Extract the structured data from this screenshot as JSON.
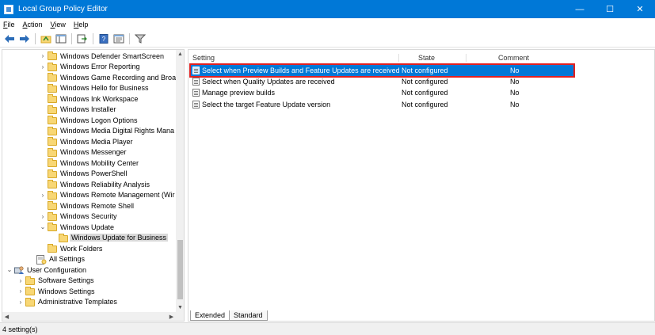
{
  "window": {
    "title": "Local Group Policy Editor",
    "controls": {
      "minimize": "—",
      "maximize": "☐",
      "close": "✕"
    }
  },
  "menu": [
    {
      "label": "File",
      "accel": "F",
      "rest": "ile"
    },
    {
      "label": "Action",
      "accel": "A",
      "rest": "ction"
    },
    {
      "label": "View",
      "accel": "V",
      "rest": "iew"
    },
    {
      "label": "Help",
      "accel": "H",
      "rest": "elp"
    }
  ],
  "toolbar": {
    "icons": [
      "back-arrow-icon",
      "forward-arrow-icon",
      "up-folder-icon",
      "show-hide-tree-icon",
      "export-list-icon",
      "help-icon",
      "properties-icon",
      "filter-icon"
    ]
  },
  "tree": {
    "items": [
      {
        "label": "Windows Defender SmartScreen",
        "level": 3,
        "expander": "›"
      },
      {
        "label": "Windows Error Reporting",
        "level": 3,
        "expander": "›"
      },
      {
        "label": "Windows Game Recording and Broa",
        "level": 3,
        "expander": ""
      },
      {
        "label": "Windows Hello for Business",
        "level": 3,
        "expander": ""
      },
      {
        "label": "Windows Ink Workspace",
        "level": 3,
        "expander": ""
      },
      {
        "label": "Windows Installer",
        "level": 3,
        "expander": ""
      },
      {
        "label": "Windows Logon Options",
        "level": 3,
        "expander": ""
      },
      {
        "label": "Windows Media Digital Rights Mana",
        "level": 3,
        "expander": ""
      },
      {
        "label": "Windows Media Player",
        "level": 3,
        "expander": ""
      },
      {
        "label": "Windows Messenger",
        "level": 3,
        "expander": ""
      },
      {
        "label": "Windows Mobility Center",
        "level": 3,
        "expander": ""
      },
      {
        "label": "Windows PowerShell",
        "level": 3,
        "expander": ""
      },
      {
        "label": "Windows Reliability Analysis",
        "level": 3,
        "expander": ""
      },
      {
        "label": "Windows Remote Management (Wir",
        "level": 3,
        "expander": "›"
      },
      {
        "label": "Windows Remote Shell",
        "level": 3,
        "expander": ""
      },
      {
        "label": "Windows Security",
        "level": 3,
        "expander": "›"
      },
      {
        "label": "Windows Update",
        "level": 3,
        "expander": "⌄"
      },
      {
        "label": "Windows Update for Business",
        "level": 4,
        "expander": "",
        "selected": true
      },
      {
        "label": "Work Folders",
        "level": 3,
        "expander": ""
      },
      {
        "label": "All Settings",
        "level": 2,
        "expander": "",
        "icon": "settings"
      },
      {
        "label": "User Configuration",
        "level": 0,
        "expander": "⌄",
        "icon": "user"
      },
      {
        "label": "Software Settings",
        "level": 1,
        "expander": "›"
      },
      {
        "label": "Windows Settings",
        "level": 1,
        "expander": "›"
      },
      {
        "label": "Administrative Templates",
        "level": 1,
        "expander": "›"
      }
    ]
  },
  "list": {
    "columns": {
      "setting": "Setting",
      "state": "State",
      "comment": "Comment"
    },
    "rows": [
      {
        "setting": "Select when Preview Builds and Feature Updates are received",
        "state": "Not configured",
        "comment": "No",
        "selected": true
      },
      {
        "setting": "Select when Quality Updates are received",
        "state": "Not configured",
        "comment": "No"
      },
      {
        "setting": "Manage preview builds",
        "state": "Not configured",
        "comment": "No"
      },
      {
        "setting": "Select the target Feature Update version",
        "state": "Not configured",
        "comment": "No"
      }
    ]
  },
  "tabs": [
    {
      "label": "Extended",
      "active": false
    },
    {
      "label": "Standard",
      "active": true
    }
  ],
  "status": {
    "text": "4 setting(s)"
  }
}
